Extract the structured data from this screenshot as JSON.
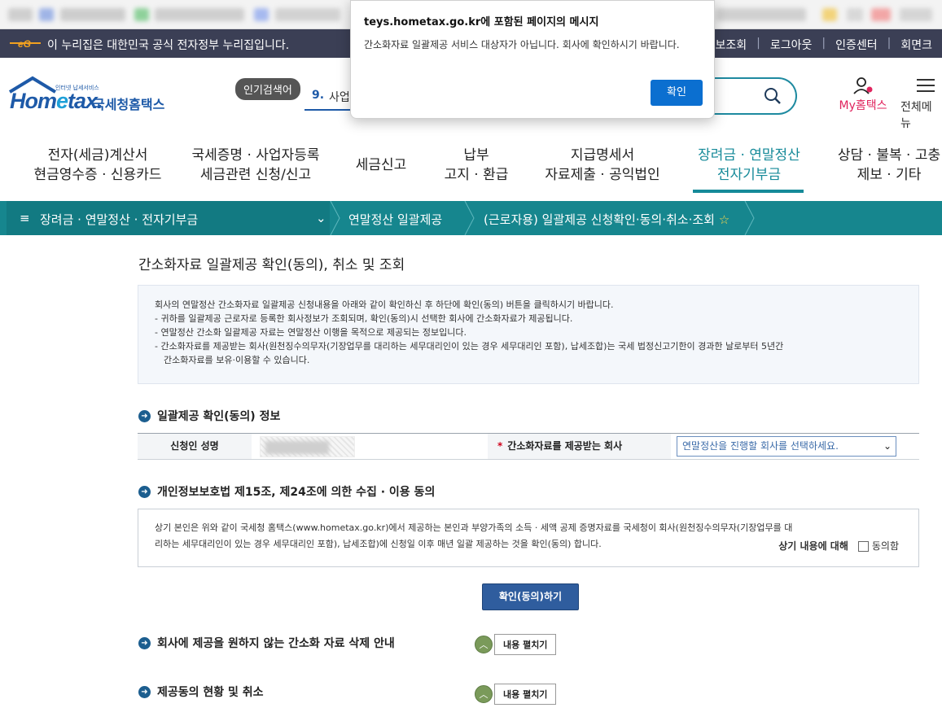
{
  "govbar": {
    "text": "이 누리집은 대한민국 공식 전자정부 누리집입니다.",
    "links": [
      "원정보조회",
      "로그아웃",
      "인증센터",
      "회면크"
    ]
  },
  "header": {
    "logo_tagline": "인터넷 납세서비스",
    "logo_home": "Hom",
    "logo_e": "e",
    "logo_tax": "tax.",
    "logo_kr": "국세청홈택스",
    "popular_label": "인기검색어",
    "popular_num": "9.",
    "popular_word": "사업",
    "my_hometax": "My홈택스",
    "all_menu": "전체메뉴"
  },
  "gnb": [
    {
      "line1": "전자(세금)계산서",
      "line2": "현금영수증 · 신용카드"
    },
    {
      "line1": "국세증명 · 사업자등록",
      "line2": "세금관련 신청/신고"
    },
    {
      "line1": "세금신고",
      "line2": ""
    },
    {
      "line1": "납부",
      "line2": "고지 · 환급"
    },
    {
      "line1": "지급명세서",
      "line2": "자료제출 · 공익법인"
    },
    {
      "line1": "장려금 · 연말정산",
      "line2": "전자기부금"
    },
    {
      "line1": "상담 · 불복 · 고충",
      "line2": "제보 · 기타"
    }
  ],
  "navbar": {
    "menu": "장려금 · 연말정산 · 전자기부금",
    "crumb1": "연말정산 일괄제공",
    "crumb2": "(근로자용) 일괄제공 신청확인·동의·취소·조회",
    "star": "☆"
  },
  "page": {
    "title": "간소화자료 일괄제공 확인(동의), 취소 및 조회",
    "info": [
      "회사의 연말정산 간소화자료 일괄제공 신청내용을 아래와 같이 확인하신 후 하단에 확인(동의) 버튼을 클릭하시기 바랍니다.",
      "- 귀하를 일괄제공 근로자로 등록한 회사정보가 조회되며, 확인(동의)시 선택한 회사에 간소화자료가 제공됩니다.",
      "- 연말정산 간소화 일괄제공 자료는 연말정산 이행을 목적으로 제공되는 정보입니다.",
      "- 간소화자료를 제공받는 회사(원천징수의무자(기장업무를 대리하는 세무대리인이 있는 경우 세무대리인 포함), 납세조합)는 국세 법정신고기한이 경과한 날로부터 5년간",
      "간소화자료를 보유·이용할 수 있습니다."
    ],
    "section1": "일괄제공 확인(동의) 정보",
    "applicant_label": "신청인 성명",
    "company_label": "간소화자료를 제공받는 회사",
    "required_mark": "*",
    "company_select": "연말정산을 진행할 회사를 선택하세요.",
    "section2": "개인정보보호법 제15조, 제24조에 의한 수집 · 이용 동의",
    "agree_text1": "상기 본인은 위와 같이 국세청 홈택스(www.hometax.go.kr)에서 제공하는 본인과 부양가족의 소득 · 세액 공제 증명자료를 국세청이 회사(원천징수의무자(기장업무를 대",
    "agree_text2": "리하는 세무대리인이 있는 경우 세무대리인 포함), 납세조합)에 신청일 이후 매년 일괄 제공하는 것을 확인(동의) 합니다.",
    "agree_about": "상기 내용에 대해",
    "agree_checkbox": "동의함",
    "confirm_button": "확인(동의)하기",
    "section3": "회사에 제공을 원하지 않는 간소화 자료 삭제 안내",
    "section4": "제공동의 현황 및 취소",
    "expand_label": "내용 펼치기"
  },
  "dialog": {
    "title": "teys.hometax.go.kr에 포함된 페이지의 메시지",
    "message": "간소화자료 일괄제공 서비스 대상자가 아닙니다. 회사에 확인하시기 바랍니다.",
    "ok": "확인"
  },
  "colors": {
    "teal": "#16868e",
    "navy": "#3b3f55",
    "brand_blue": "#1e5aa8",
    "dialog_button": "#0b6fd0"
  }
}
